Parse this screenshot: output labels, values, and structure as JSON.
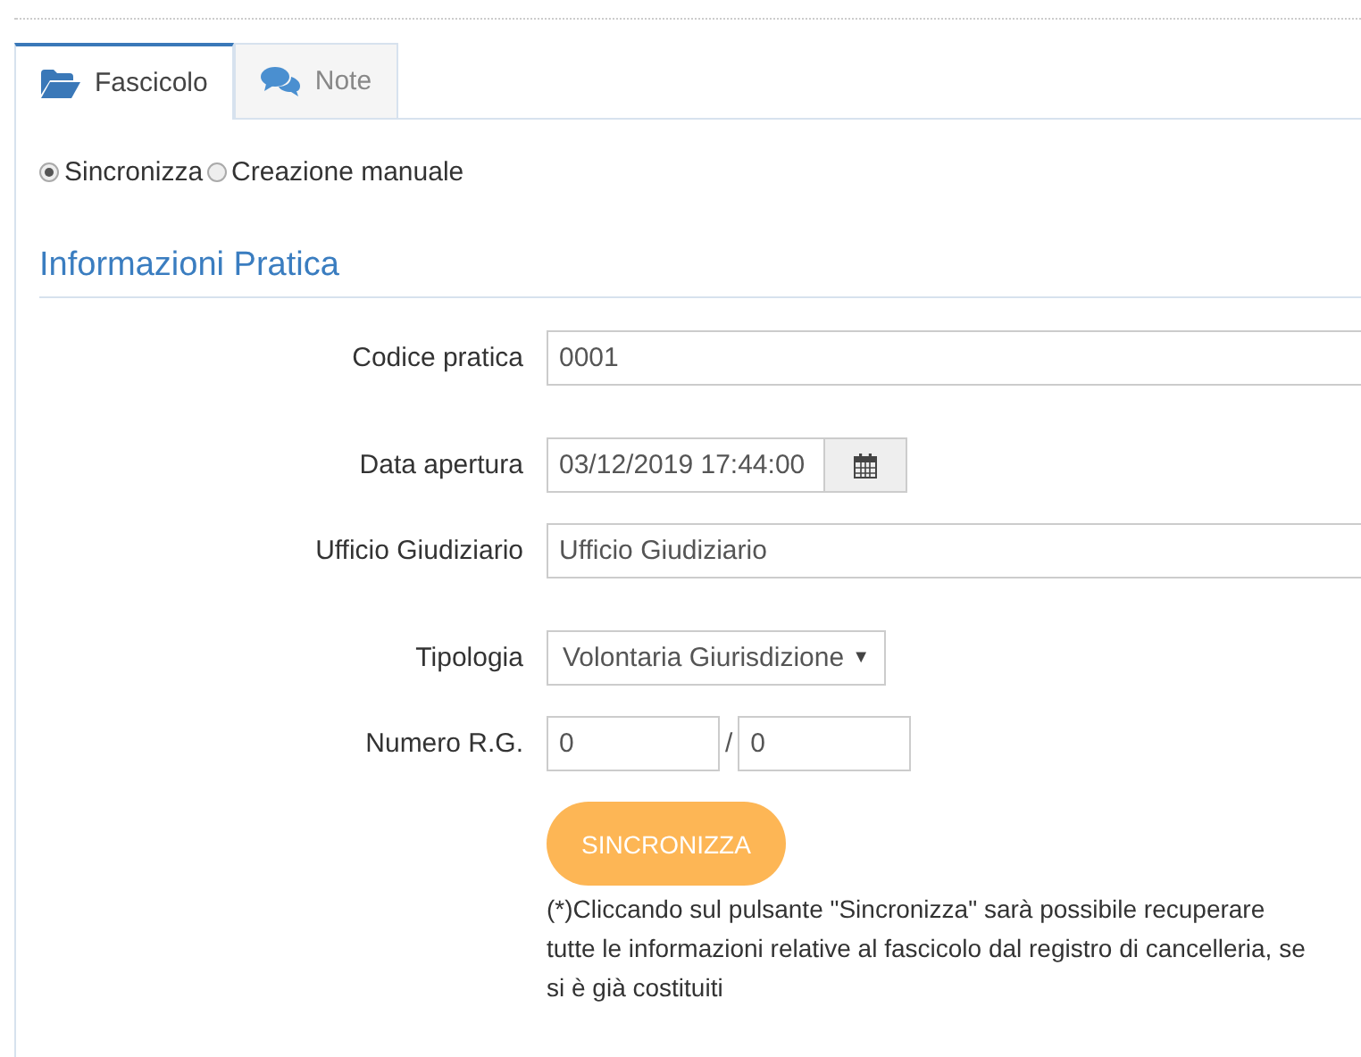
{
  "tabs": [
    {
      "label": "Fascicolo",
      "kind": "folder",
      "selected": true
    },
    {
      "label": "Note",
      "kind": "chat",
      "selected": false
    }
  ],
  "mode": [
    {
      "label": "Sincronizza",
      "selected": true
    },
    {
      "label": "Creazione manuale",
      "selected": false
    }
  ],
  "section_title": "Informazioni Pratica",
  "fields": [
    {
      "kind": "text",
      "label": "Codice pratica",
      "value": "0001"
    },
    {
      "kind": "date",
      "label": "Data apertura",
      "value": "03/12/2019 17:44:00"
    },
    {
      "kind": "text",
      "label": "Ufficio Giudiziario",
      "value": "Ufficio Giudiziario"
    },
    {
      "kind": "select",
      "label": "Tipologia",
      "value": "Volontaria Giurisdizione",
      "caret": "▼"
    },
    {
      "kind": "pair",
      "label": "Numero R.G.",
      "value": "0",
      "separator": "/",
      "value_2": "0"
    }
  ],
  "sync_button": "SINCRONIZZA",
  "note": "(*)Cliccando sul pulsante \"Sincronizza\" sarà possibile recuperare tutte le informazioni relative al fascicolo dal registro di cancelleria, se si è già costituiti"
}
